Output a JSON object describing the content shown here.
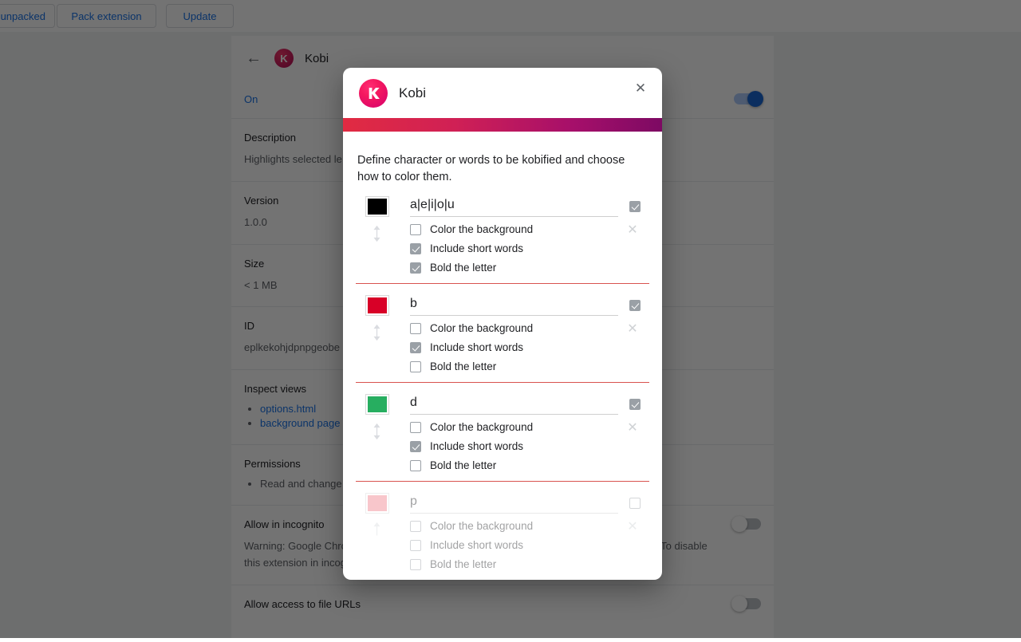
{
  "browser_toolbar": {
    "buttons": [
      {
        "name": "load-unpacked",
        "label": "Load unpacked"
      },
      {
        "name": "pack-extension",
        "label": "Pack extension"
      },
      {
        "name": "update",
        "label": "Update"
      }
    ]
  },
  "extension_detail": {
    "title": "Kobi",
    "icon_letter": "K",
    "back_icon": "←",
    "enabled_label": "On",
    "enabled": true,
    "sections": {
      "description_label": "Description",
      "description_value": "Highlights selected le",
      "version_label": "Version",
      "version_value": "1.0.0",
      "size_label": "Size",
      "size_value": "< 1 MB",
      "id_label": "ID",
      "id_value": "eplkekohjdpnpgeobe",
      "inspect_views_label": "Inspect views",
      "inspect_views": [
        "options.html",
        "background page"
      ],
      "permissions_label": "Permissions",
      "permissions": [
        "Read and change"
      ],
      "incognito_label": "Allow in incognito",
      "incognito_warning": "Warning: Google Chrome cannot prevent extensions from recording your browsing history. To disable this extension in incognito mode, unselect this option.",
      "incognito_enabled": false,
      "file_urls_label": "Allow access to file URLs"
    }
  },
  "dialog": {
    "title": "Kobi",
    "close_icon": "✕",
    "description": "Define character or words to be kobified and choose how to color them.",
    "accent_gradient_from": "#e12b42",
    "accent_gradient_to": "#7d0a63",
    "divider_color": "#d9534f",
    "option_labels": {
      "color_background": "Color the background",
      "include_short_words": "Include short words",
      "bold_the_letter": "Bold the letter"
    },
    "rules": [
      {
        "color": "#000000",
        "pattern": "a|e|i|o|u",
        "enabled": true,
        "color_background": false,
        "include_short_words": true,
        "bold_the_letter": true,
        "disabled_row": false
      },
      {
        "color": "#d80027",
        "pattern": "b",
        "enabled": true,
        "color_background": false,
        "include_short_words": true,
        "bold_the_letter": false,
        "disabled_row": false
      },
      {
        "color": "#27ae60",
        "pattern": "d",
        "enabled": true,
        "color_background": false,
        "include_short_words": true,
        "bold_the_letter": false,
        "disabled_row": false
      },
      {
        "color": "#ef7a85",
        "pattern": "p",
        "enabled": false,
        "color_background": false,
        "include_short_words": false,
        "bold_the_letter": false,
        "disabled_row": true
      }
    ],
    "drag_icon": "⇅",
    "delete_icon": "✕"
  }
}
